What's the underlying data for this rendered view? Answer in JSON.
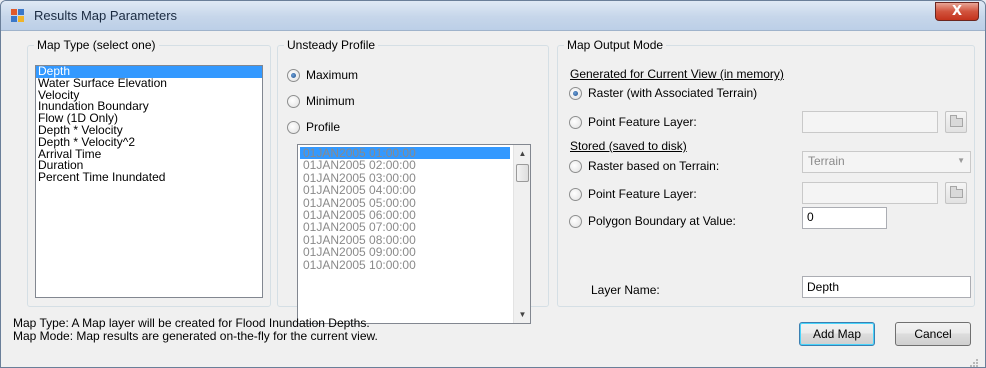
{
  "window": {
    "title": "Results Map Parameters",
    "close_glyph": "X",
    "icon": "map-window-icon"
  },
  "map_type": {
    "title": "Map Type (select one)",
    "items": [
      "Depth",
      "Water Surface Elevation",
      "Velocity",
      "Inundation Boundary",
      "Flow (1D Only)",
      "Depth * Velocity",
      "Depth * Velocity^2",
      "Arrival Time",
      "Duration",
      "Percent Time Inundated"
    ],
    "selected": "Depth"
  },
  "unsteady_profile": {
    "title": "Unsteady Profile",
    "options": [
      "Maximum",
      "Minimum",
      "Profile"
    ],
    "selected": "Maximum",
    "profiles": [
      "01JAN2005 01:00:00",
      "01JAN2005 02:00:00",
      "01JAN2005 03:00:00",
      "01JAN2005 04:00:00",
      "01JAN2005 05:00:00",
      "01JAN2005 06:00:00",
      "01JAN2005 07:00:00",
      "01JAN2005 08:00:00",
      "01JAN2005 09:00:00",
      "01JAN2005 10:00:00"
    ],
    "selected_profile": "01JAN2005 01:00:00"
  },
  "output_mode": {
    "title": "Map Output Mode",
    "current_view_heading": "Generated for Current View (in memory)",
    "raster_associated": "Raster (with Associated Terrain)",
    "point_feature_layer": "Point Feature Layer:",
    "stored_heading": "Stored (saved to disk)",
    "raster_terrain": "Raster based on Terrain:",
    "terrain_value": "Terrain",
    "stored_point_feature_layer": "Point Feature Layer:",
    "polygon_boundary": "Polygon Boundary at Value:",
    "polygon_value": "0",
    "layer_name_label": "Layer Name:",
    "layer_name_value": "Depth",
    "selected": "Raster (with Associated Terrain)"
  },
  "status": {
    "line1": "Map Type: A Map layer will be created for Flood Inundation Depths.",
    "line2": "Map Mode: Map results are generated on-the-fly for the current view."
  },
  "buttons": {
    "add_map": "Add Map",
    "cancel": "Cancel"
  }
}
